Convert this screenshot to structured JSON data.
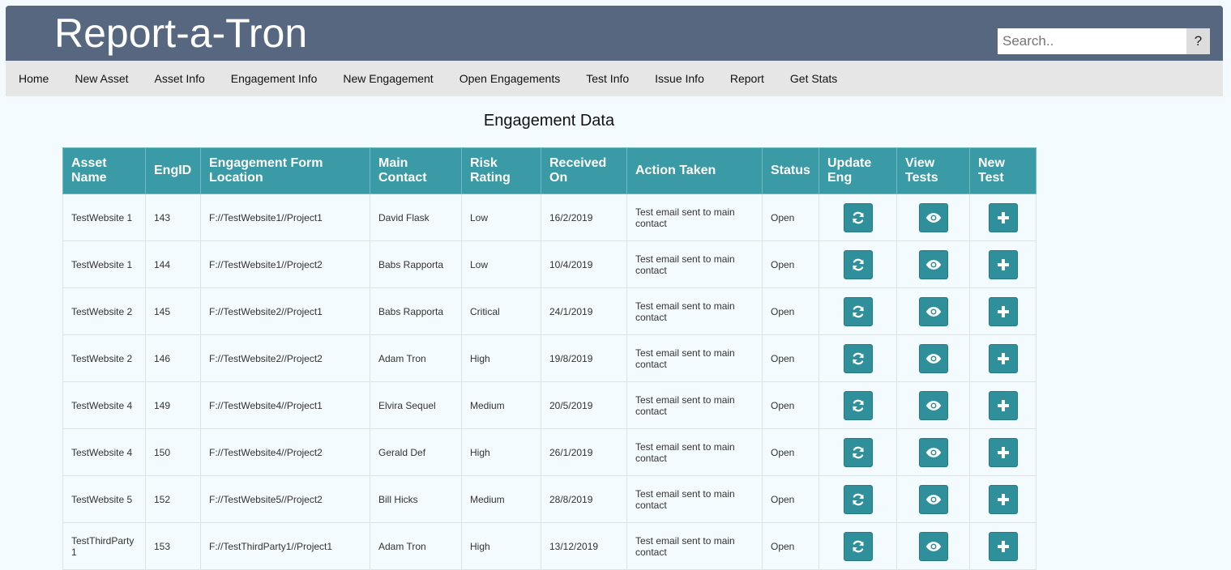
{
  "app": {
    "title": "Report-a-Tron"
  },
  "search": {
    "placeholder": "Search..",
    "value": "",
    "help_label": "?"
  },
  "nav": {
    "items": [
      {
        "label": "Home"
      },
      {
        "label": "New Asset"
      },
      {
        "label": "Asset Info"
      },
      {
        "label": "Engagement Info"
      },
      {
        "label": "New Engagement"
      },
      {
        "label": "Open Engagements"
      },
      {
        "label": "Test Info"
      },
      {
        "label": "Issue Info"
      },
      {
        "label": "Report"
      },
      {
        "label": "Get Stats"
      }
    ]
  },
  "page": {
    "title": "Engagement Data"
  },
  "table": {
    "headers": [
      "Asset Name",
      "EngID",
      "Engagement Form Location",
      "Main Contact",
      "Risk Rating",
      "Received On",
      "Action Taken",
      "Status",
      "Update Eng",
      "View Tests",
      "New Test"
    ],
    "rows": [
      {
        "asset": "TestWebsite 1",
        "engid": "143",
        "location": "F://TestWebsite1//Project1",
        "contact": "David Flask",
        "risk": "Low",
        "received": "16/2/2019",
        "action": "Test email sent to main contact",
        "status": "Open"
      },
      {
        "asset": "TestWebsite 1",
        "engid": "144",
        "location": "F://TestWebsite1//Project2",
        "contact": "Babs Rapporta",
        "risk": "Low",
        "received": "10/4/2019",
        "action": "Test email sent to main contact",
        "status": "Open"
      },
      {
        "asset": "TestWebsite 2",
        "engid": "145",
        "location": "F://TestWebsite2//Project1",
        "contact": "Babs Rapporta",
        "risk": "Critical",
        "received": "24/1/2019",
        "action": "Test email sent to main contact",
        "status": "Open"
      },
      {
        "asset": "TestWebsite 2",
        "engid": "146",
        "location": "F://TestWebsite2//Project2",
        "contact": "Adam Tron",
        "risk": "High",
        "received": "19/8/2019",
        "action": "Test email sent to main contact",
        "status": "Open"
      },
      {
        "asset": "TestWebsite 4",
        "engid": "149",
        "location": "F://TestWebsite4//Project1",
        "contact": "Elvira Sequel",
        "risk": "Medium",
        "received": "20/5/2019",
        "action": "Test email sent to main contact",
        "status": "Open"
      },
      {
        "asset": "TestWebsite 4",
        "engid": "150",
        "location": "F://TestWebsite4//Project2",
        "contact": "Gerald Def",
        "risk": "High",
        "received": "26/1/2019",
        "action": "Test email sent to main contact",
        "status": "Open"
      },
      {
        "asset": "TestWebsite 5",
        "engid": "152",
        "location": "F://TestWebsite5//Project2",
        "contact": "Bill Hicks",
        "risk": "Medium",
        "received": "28/8/2019",
        "action": "Test email sent to main contact",
        "status": "Open"
      },
      {
        "asset": "TestThirdParty 1",
        "engid": "153",
        "location": "F://TestThirdParty1//Project1",
        "contact": "Adam Tron",
        "risk": "High",
        "received": "13/12/2019",
        "action": "Test email sent to main contact",
        "status": "Open"
      }
    ],
    "row_actions": {
      "update_icon": "refresh-icon",
      "view_icon": "eye-icon",
      "new_icon": "plus-icon"
    }
  },
  "colors": {
    "header_bg": "#57677f",
    "nav_bg": "#e6e6e6",
    "table_header_bg": "#3a9aa6",
    "action_button_bg": "#2f8f9b",
    "page_bg": "#f3fbfe"
  }
}
